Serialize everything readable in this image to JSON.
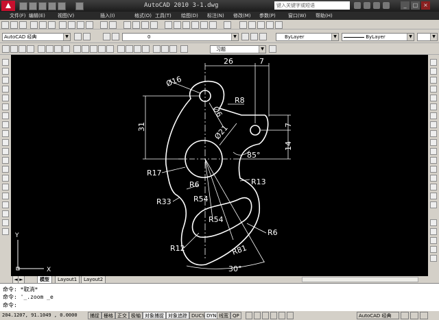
{
  "window": {
    "title": "AutoCAD 2010   3-1.dwg",
    "search_placeholder": "键入关键字或短语",
    "controls": [
      "_",
      "□",
      "×"
    ]
  },
  "menu": [
    "文件(F)",
    "编辑(E)",
    "视图(V)",
    "插入(I)",
    "格式(O)",
    "工具(T)",
    "绘图(D)",
    "标注(N)",
    "修改(M)",
    "参数(P)",
    "窗口(W)",
    "帮助(H)"
  ],
  "toolbar": {
    "workspace": "AutoCAD 经典",
    "layer": "0",
    "color": "ByLayer",
    "linetype": "ByLayer",
    "dim_style": "习题"
  },
  "drawing": {
    "dimensions": [
      "26",
      "7",
      "Ø16",
      "R8",
      "Ø6",
      "31",
      "Ø21",
      "7",
      "14",
      "85°",
      "R17",
      "R6",
      "R13",
      "R33",
      "R54",
      "R54",
      "R6",
      "R12",
      "R81",
      "30°"
    ],
    "ucs": {
      "x_label": "X",
      "y_label": "Y"
    }
  },
  "tabs": [
    "模型",
    "Layout1",
    "Layout2"
  ],
  "command": {
    "line1": "命令: *取消*",
    "line2": "命令: '_.zoom _e",
    "prompt": "命令:"
  },
  "status": {
    "coords": "204.1207, 91.1049 , 0.0000",
    "toggles": [
      "捕捉",
      "栅格",
      "正交",
      "极轴",
      "对象捕捉",
      "对象追踪",
      "DUCS",
      "DYN",
      "线宽",
      "QP"
    ],
    "workspace": "AutoCAD 经典"
  }
}
